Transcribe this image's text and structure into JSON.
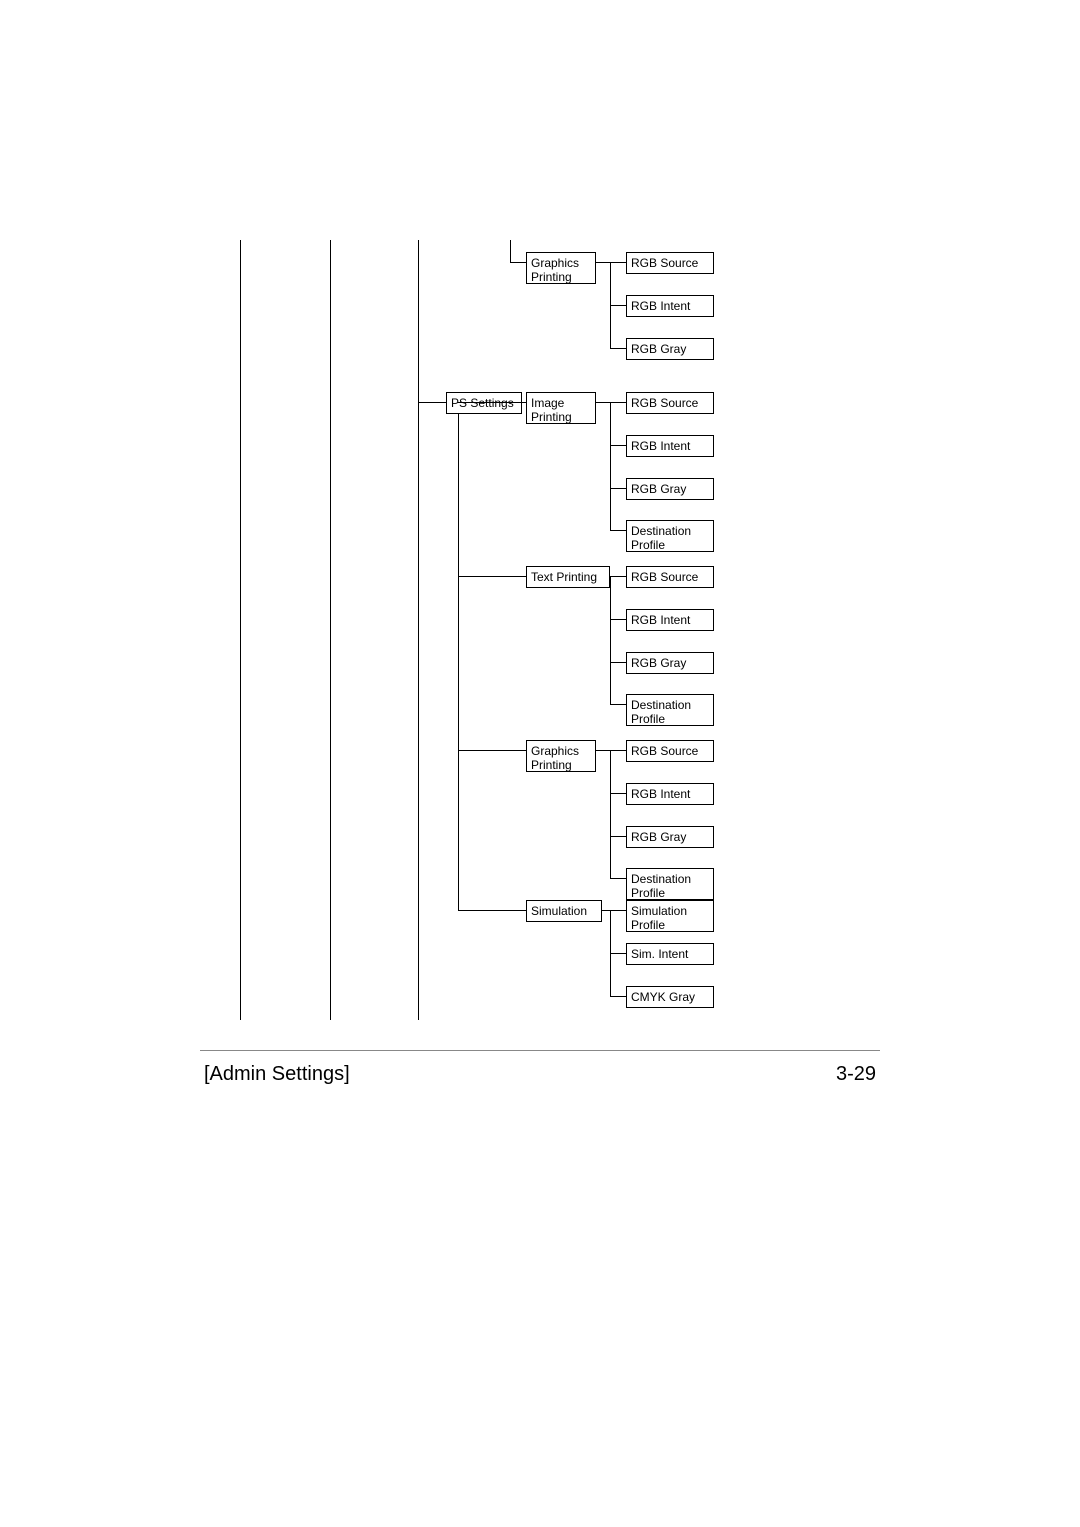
{
  "footer": {
    "left": "[Admin Settings]",
    "right": "3-29"
  },
  "tree": {
    "ps_settings": "PS Settings",
    "graphics_printing_top": {
      "label": "Graphics\nPrinting",
      "children": [
        "RGB Source",
        "RGB Intent",
        "RGB Gray"
      ]
    },
    "image_printing": {
      "label": "Image\nPrinting",
      "children": [
        "RGB Source",
        "RGB Intent",
        "RGB Gray",
        "Destination\nProfile"
      ]
    },
    "text_printing": {
      "label": "Text Printing",
      "children": [
        "RGB Source",
        "RGB Intent",
        "RGB Gray",
        "Destination\nProfile"
      ]
    },
    "graphics_printing": {
      "label": "Graphics\nPrinting",
      "children": [
        "RGB Source",
        "RGB Intent",
        "RGB Gray",
        "Destination\nProfile"
      ]
    },
    "simulation": {
      "label": "Simulation",
      "children": [
        "Simulation\nProfile",
        "Sim. Intent",
        "CMYK Gray"
      ]
    }
  }
}
